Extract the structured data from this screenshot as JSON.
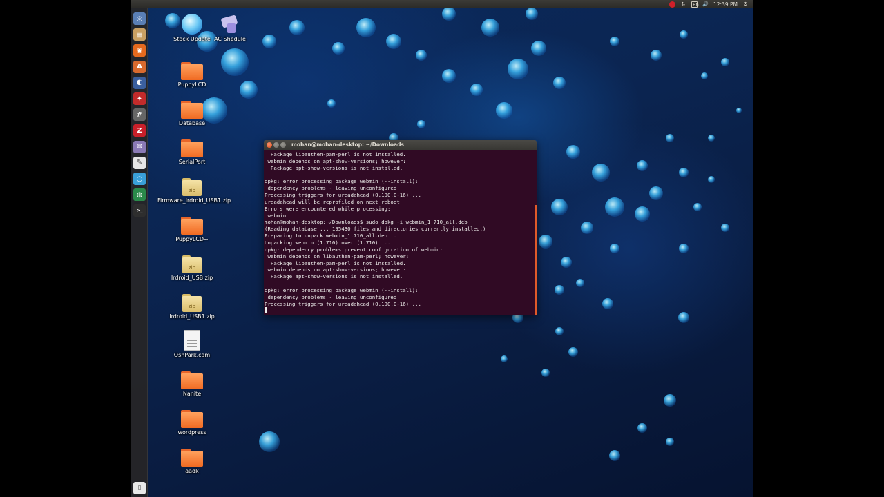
{
  "top_panel": {
    "clock": "12:39 PM",
    "keyboard_layout": "En",
    "tray_icons": [
      "recording-icon",
      "network-transfer-icon",
      "keyboard-icon",
      "volume-icon",
      "clock",
      "gear-icon"
    ]
  },
  "launcher": {
    "items": [
      {
        "name": "dash-home-icon",
        "glyph": "◎",
        "color": "#5a7fb5"
      },
      {
        "name": "files-icon",
        "glyph": "▤",
        "color": "#c9a063"
      },
      {
        "name": "firefox-icon",
        "glyph": "◉",
        "color": "#e56a1e"
      },
      {
        "name": "software-center-icon",
        "glyph": "A",
        "color": "#d86a2e"
      },
      {
        "name": "eclipse-icon",
        "glyph": "◐",
        "color": "#3a5f9f"
      },
      {
        "name": "tool-icon",
        "glyph": "✦",
        "color": "#c22b2b"
      },
      {
        "name": "calculator-icon",
        "glyph": "#",
        "color": "#666666"
      },
      {
        "name": "filezilla-icon",
        "glyph": "Z",
        "color": "#c8202a"
      },
      {
        "name": "mail-icon",
        "glyph": "✉",
        "color": "#8a7ab5"
      },
      {
        "name": "text-editor-icon",
        "glyph": "✎",
        "color": "#e6e6e6"
      },
      {
        "name": "browser-icon",
        "glyph": "○",
        "color": "#3aa0d8"
      },
      {
        "name": "globe-icon",
        "glyph": "◍",
        "color": "#2a8a4a"
      },
      {
        "name": "terminal-icon",
        "glyph": ">_",
        "color": "#2e2e2e"
      }
    ],
    "trash": {
      "name": "trash-icon",
      "glyph": "🗑"
    }
  },
  "desktop": {
    "icons": [
      {
        "label": "Stock Update",
        "type": "app-globe"
      },
      {
        "label": "AC Shedule",
        "type": "app-stamp"
      },
      {
        "label": "PuppyLCD",
        "type": "folder"
      },
      {
        "label": "Database",
        "type": "folder"
      },
      {
        "label": "SerialPort",
        "type": "folder"
      },
      {
        "label": "Firmware_Irdroid_USB1.zip",
        "type": "zip"
      },
      {
        "label": "PuppyLCD~",
        "type": "folder"
      },
      {
        "label": "Irdroid_USB.zip",
        "type": "zip"
      },
      {
        "label": "Irdroid_USB1.zip",
        "type": "zip"
      },
      {
        "label": "OshPark.cam",
        "type": "document"
      },
      {
        "label": "Nanite",
        "type": "folder"
      },
      {
        "label": "wordpress",
        "type": "folder"
      },
      {
        "label": "aadk",
        "type": "folder"
      }
    ],
    "zip_badge": "zip"
  },
  "terminal": {
    "title": "mohan@mohan-desktop: ~/Downloads",
    "lines": [
      "  Package libauthen-pam-perl is not installed.",
      " webmin depends on apt-show-versions; however:",
      "  Package apt-show-versions is not installed.",
      "",
      "dpkg: error processing package webmin (--install):",
      " dependency problems - leaving unconfigured",
      "Processing triggers for ureadahead (0.100.0-16) ...",
      "ureadahead will be reprofiled on next reboot",
      "Errors were encountered while processing:",
      " webmin",
      "mohan@mohan-desktop:~/Downloads$ sudo dpkg -i webmin_1.710_all.deb",
      "(Reading database ... 195430 files and directories currently installed.)",
      "Preparing to unpack webmin_1.710_all.deb ...",
      "Unpacking webmin (1.710) over (1.710) ...",
      "dpkg: dependency problems prevent configuration of webmin:",
      " webmin depends on libauthen-pam-perl; however:",
      "  Package libauthen-pam-perl is not installed.",
      " webmin depends on apt-show-versions; however:",
      "  Package apt-show-versions is not installed.",
      "",
      "dpkg: error processing package webmin (--install):",
      " dependency problems - leaving unconfigured",
      "Processing triggers for ureadahead (0.100.0-16) ..."
    ],
    "colors": {
      "background": "#300a24",
      "text": "#eeeeec"
    }
  }
}
